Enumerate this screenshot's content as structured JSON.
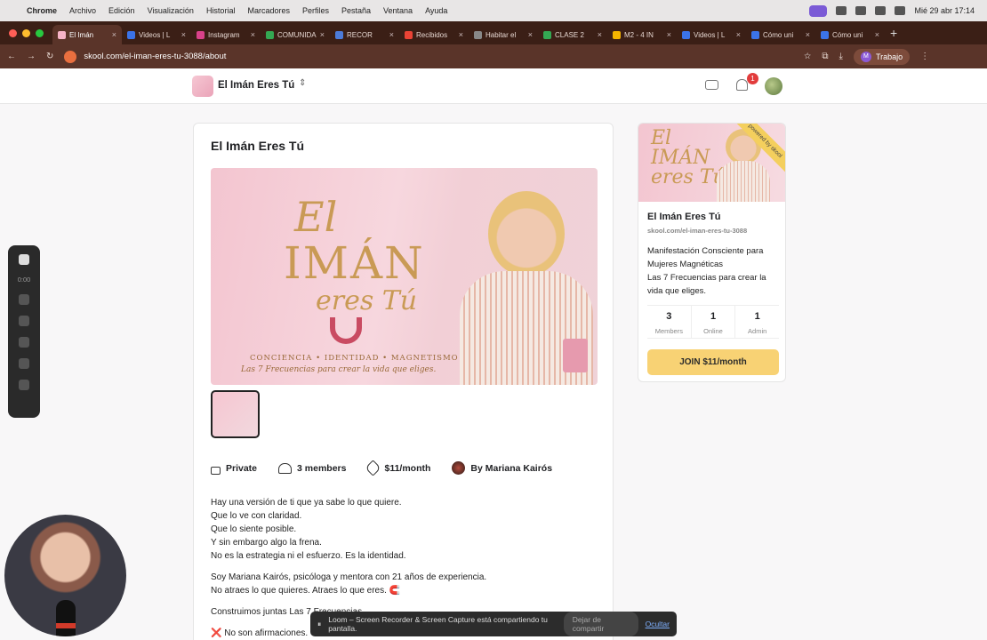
{
  "mac": {
    "menu": [
      "Chrome",
      "Archivo",
      "Edición",
      "Visualización",
      "Historial",
      "Marcadores",
      "Perfiles",
      "Pestaña",
      "Ventana",
      "Ayuda"
    ],
    "datetime": "Mié 29 abr 17:14"
  },
  "tabs": [
    {
      "label": "El Imán",
      "color": "#f6b3c7",
      "active": true
    },
    {
      "label": "Videos | L",
      "color": "#3b73e8"
    },
    {
      "label": "Instagram",
      "color": "#d8428a"
    },
    {
      "label": "COMUNIDA",
      "color": "#34a853"
    },
    {
      "label": "RECOR",
      "color": "#4c7bd9"
    },
    {
      "label": "Recibidos",
      "color": "#ea4335"
    },
    {
      "label": "Habitar el",
      "color": "#888888"
    },
    {
      "label": "CLASE 2",
      "color": "#34a853"
    },
    {
      "label": "M2 - 4 IN",
      "color": "#f4b400"
    },
    {
      "label": "Videos | L",
      "color": "#3b73e8"
    },
    {
      "label": "Cómo uni",
      "color": "#3b73e8"
    },
    {
      "label": "Cómo uni",
      "color": "#3b73e8"
    }
  ],
  "address": {
    "url": "skool.com/el-iman-eres-tu-3088/about",
    "profile": "Trabajo",
    "profile_initial": "M"
  },
  "skool": {
    "group_name": "El Imán Eres Tú",
    "notifications": "1",
    "title": "El Imán Eres Tú",
    "hero": {
      "line1": "El",
      "line2": "IMÁN",
      "line3": "eres Tú",
      "tagline": "CONCIENCIA • IDENTIDAD • MAGNETISMO",
      "subtagline": "Las 7 Frecuencias para crear la vida que eliges."
    },
    "meta": {
      "privacy": "Private",
      "members": "3 members",
      "price": "$11/month",
      "author": "By Mariana Kairós"
    },
    "description": [
      "Hay una versión de ti que ya sabe lo que quiere.\nQue lo ve con claridad.\nQue lo siente posible.\nY sin embargo algo la frena.\nNo es la estrategia ni el esfuerzo. Es la identidad.",
      "Soy Mariana Kairós, psicóloga y mentora con 21 años de experiencia.\nNo atraes lo que quieres. Atraes lo que eres. 🧲",
      "Construimos juntas Las 7 Frecuencias.",
      "❌ No son afirmaciones."
    ],
    "side": {
      "name": "El Imán Eres Tú",
      "url": "skool.com/el-iman-eres-tu-3088",
      "desc": "Manifestación Consciente para Mujeres Magnéticas\nLas 7 Frecuencias para crear la vida que eliges.",
      "ribbon": "powered by skool",
      "stats": [
        {
          "value": "3",
          "label": "Members"
        },
        {
          "value": "1",
          "label": "Online"
        },
        {
          "value": "1",
          "label": "Admin"
        }
      ],
      "join": "JOIN $11/month"
    }
  },
  "loom": {
    "timer": "0:00",
    "banner": "Loom – Screen Recorder & Screen Capture está compartiendo tu pantalla.",
    "stop": "Dejar de compartir",
    "hide": "Ocultar"
  }
}
